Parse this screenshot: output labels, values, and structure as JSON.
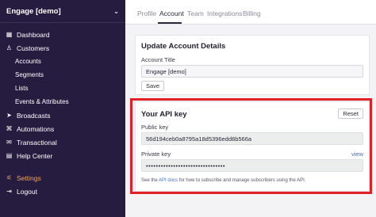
{
  "sidebar": {
    "brand": "Engage [demo]",
    "items": [
      {
        "label": "Dashboard",
        "icon": "dashboard-icon",
        "glyph": "▦"
      },
      {
        "label": "Customers",
        "icon": "users-icon",
        "glyph": "♙"
      },
      {
        "label": "Accounts"
      },
      {
        "label": "Segments"
      },
      {
        "label": "Lists"
      },
      {
        "label": "Events & Attributes"
      },
      {
        "label": "Broadcasts",
        "icon": "paper-plane-icon",
        "glyph": "➤"
      },
      {
        "label": "Automations",
        "icon": "automation-icon",
        "glyph": "⌘"
      },
      {
        "label": "Transactional",
        "icon": "mail-icon",
        "glyph": "✉"
      },
      {
        "label": "Help Center",
        "icon": "help-center-icon",
        "glyph": "▤"
      },
      {
        "label": "Settings",
        "icon": "settings-icon",
        "glyph": "⚟"
      },
      {
        "label": "Logout",
        "icon": "logout-icon",
        "glyph": "⇥"
      }
    ]
  },
  "tabs": [
    "Profile",
    "Account",
    "Team",
    "Integrations",
    "Billing"
  ],
  "account_details": {
    "title": "Update Account Details",
    "field_label": "Account Title",
    "field_value": "Engage [demo]",
    "save_label": "Save"
  },
  "api_key": {
    "title": "Your API key",
    "reset_label": "Reset",
    "public_label": "Public key",
    "public_value": "56d194ceb0a8795a18d5396edd8b566a",
    "private_label": "Private key",
    "private_value": "••••••••••••••••••••••••••••••••",
    "view_label": "view",
    "help_prefix": "See the ",
    "help_link": "API docs",
    "help_suffix": " for how to subscribe and manage subscribers using the API."
  },
  "colors": {
    "sidebar_bg": "#251c3f",
    "active_accent": "#f0a65c",
    "highlight": "#e01f26",
    "link": "#3c6fd6"
  }
}
